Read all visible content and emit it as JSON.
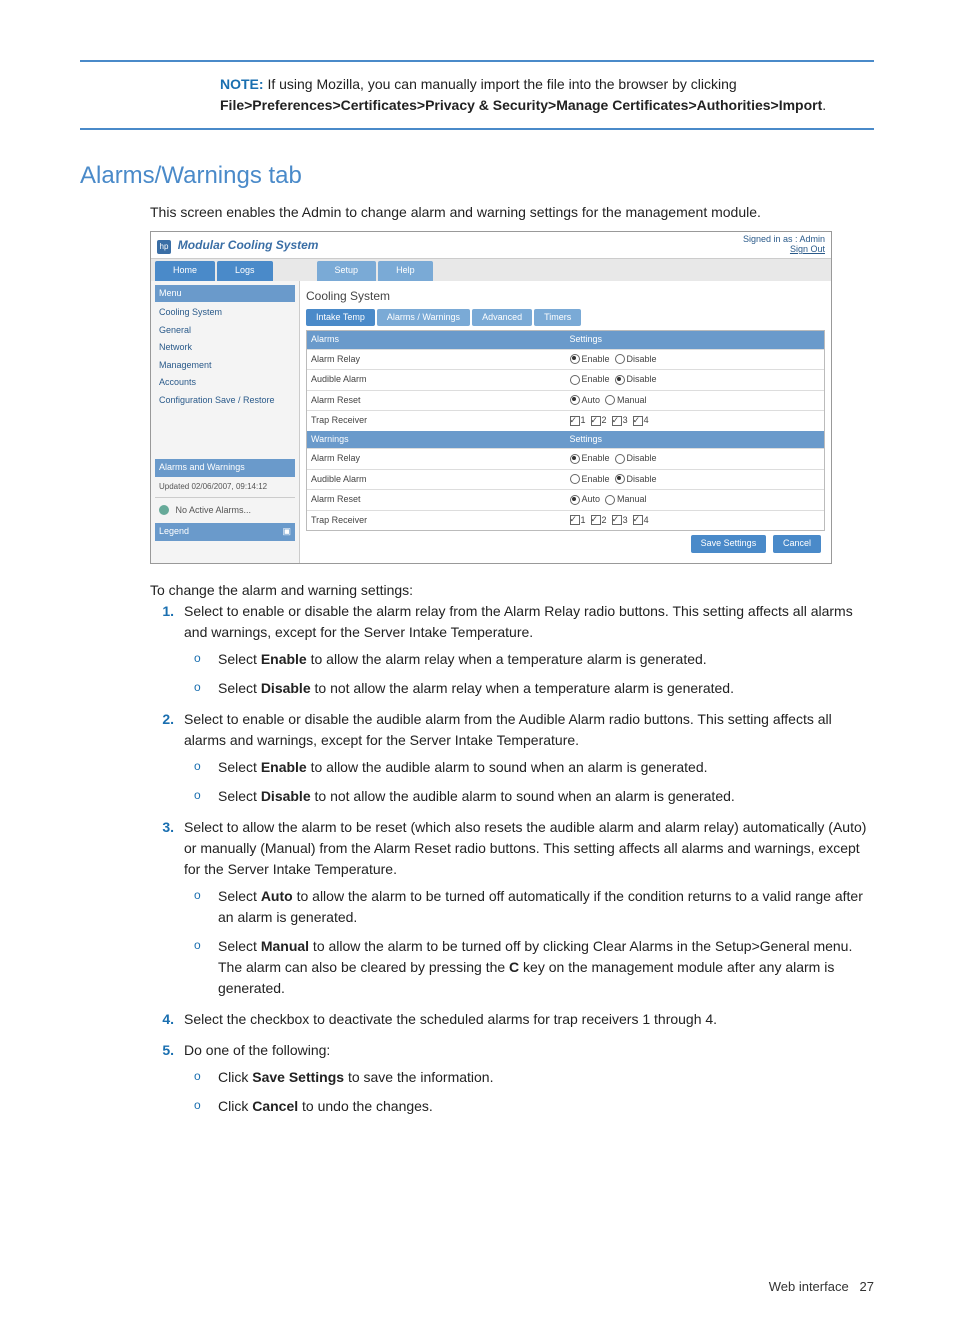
{
  "note": {
    "label": "NOTE:",
    "text": "If using Mozilla, you can manually import the file into the browser by clicking",
    "path": "File>Preferences>Certificates>Privacy & Security>Manage Certificates>Authorities>Import"
  },
  "section_title": "Alarms/Warnings tab",
  "section_intro": "This screen enables the Admin to change alarm and warning settings for the management module.",
  "app": {
    "title": "Modular Cooling System",
    "signed_in": "Signed in as : Admin",
    "sign_out": "Sign Out",
    "tabs": {
      "home": "Home",
      "logs": "Logs",
      "setup": "Setup",
      "help": "Help"
    },
    "menu_head": "Menu",
    "menu": {
      "cooling": "Cooling System",
      "general": "General",
      "network": "Network",
      "management": "Management",
      "accounts": "Accounts",
      "config": "Configuration Save / Restore"
    },
    "status_head": "Alarms and Warnings",
    "updated": "Updated 02/06/2007, 09:14:12",
    "no_alarms": "No Active Alarms...",
    "legend": "Legend",
    "main_title": "Cooling System",
    "subtabs": {
      "intake": "Intake Temp",
      "aw": "Alarms / Warnings",
      "adv": "Advanced",
      "timers": "Timers"
    },
    "hdr_alarms": "Alarms",
    "hdr_warnings": "Warnings",
    "hdr_settings": "Settings",
    "rows": {
      "relay": "Alarm Relay",
      "audible": "Audible Alarm",
      "reset": "Alarm Reset",
      "trap": "Trap Receiver"
    },
    "opts": {
      "enable": "Enable",
      "disable": "Disable",
      "auto": "Auto",
      "manual": "Manual"
    },
    "cb": {
      "1": "1",
      "2": "2",
      "3": "3",
      "4": "4"
    },
    "btn_save": "Save Settings",
    "btn_cancel": "Cancel"
  },
  "instr_lead": "To change the alarm and warning settings:",
  "steps": {
    "1": "Select to enable or disable the alarm relay from the Alarm Relay radio buttons. This setting affects all alarms and warnings, except for the Server Intake Temperature.",
    "1a_pre": "Select ",
    "1a_b": "Enable",
    "1a_post": " to allow the alarm relay when a temperature alarm is generated.",
    "1b_pre": "Select ",
    "1b_b": "Disable",
    "1b_post": " to not allow the alarm relay when a temperature alarm is generated.",
    "2": "Select to enable or disable the audible alarm from the Audible Alarm radio buttons. This setting affects all alarms and warnings, except for the Server Intake Temperature.",
    "2a_pre": "Select ",
    "2a_b": "Enable",
    "2a_post": " to allow the audible alarm to sound when an alarm is generated.",
    "2b_pre": "Select ",
    "2b_b": "Disable",
    "2b_post": " to not allow the audible alarm to sound when an alarm is generated.",
    "3": "Select to allow the alarm to be reset (which also resets the audible alarm and alarm relay) automatically (Auto) or manually (Manual) from the Alarm Reset radio buttons. This setting affects all alarms and warnings, except for the Server Intake Temperature.",
    "3a_pre": "Select ",
    "3a_b": "Auto",
    "3a_post": " to allow the alarm to be turned off automatically if the condition returns to a valid range after an alarm is generated.",
    "3b_pre": "Select ",
    "3b_b": "Manual",
    "3b_mid": " to allow the alarm to be turned off by clicking Clear Alarms in the Setup>General menu. The alarm can also be cleared by pressing the ",
    "3b_b2": "C",
    "3b_post": " key on the management module after any alarm is generated.",
    "4": "Select the checkbox to deactivate the scheduled alarms for trap receivers 1 through 4.",
    "5": "Do one of the following:",
    "5a_pre": "Click ",
    "5a_b": "Save Settings",
    "5a_post": " to save the information.",
    "5b_pre": "Click ",
    "5b_b": "Cancel",
    "5b_post": " to undo the changes."
  },
  "footer": {
    "label": "Web interface",
    "page": "27"
  }
}
